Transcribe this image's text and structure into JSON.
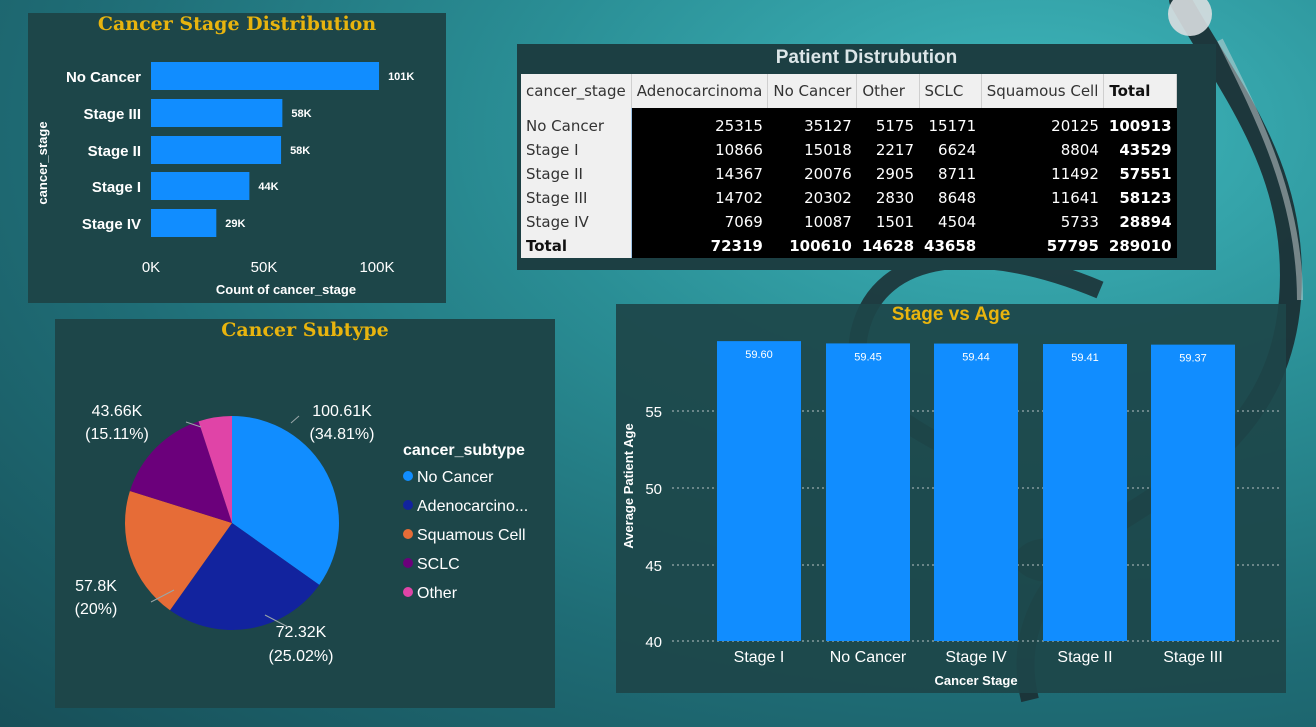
{
  "colors": {
    "bar": "#118dff",
    "title": "#e8b40e",
    "panel": "#1d4649"
  },
  "stage_chart": {
    "title": "Cancer Stage Distribution",
    "xlabel": "Count of cancer_stage",
    "ylabel": "cancer_stage",
    "ticks": [
      "0K",
      "50K",
      "100K"
    ]
  },
  "pivot": {
    "title": "Patient Distrubution",
    "columns": [
      "cancer_stage",
      "Adenocarcinoma",
      "No Cancer",
      "Other",
      "SCLC",
      "Squamous Cell",
      "Total"
    ],
    "rows": [
      [
        "No Cancer",
        "25315",
        "35127",
        "5175",
        "15171",
        "20125",
        "100913"
      ],
      [
        "Stage I",
        "10866",
        "15018",
        "2217",
        "6624",
        "8804",
        "43529"
      ],
      [
        "Stage II",
        "14367",
        "20076",
        "2905",
        "8711",
        "11492",
        "57551"
      ],
      [
        "Stage III",
        "14702",
        "20302",
        "2830",
        "8648",
        "11641",
        "58123"
      ],
      [
        "Stage IV",
        "7069",
        "10087",
        "1501",
        "4504",
        "5733",
        "28894"
      ]
    ],
    "total": [
      "Total",
      "72319",
      "100610",
      "14628",
      "43658",
      "57795",
      "289010"
    ]
  },
  "subtype_chart": {
    "title": "Cancer Subtype",
    "legend_title": "cancer_subtype",
    "legend": [
      "No Cancer",
      "Adenocarcino...",
      "Squamous Cell",
      "SCLC",
      "Other"
    ],
    "slice_labels": [
      {
        "value": "100.61K",
        "pct": "(34.81%)"
      },
      {
        "value": "72.32K",
        "pct": "(25.02%)"
      },
      {
        "value": "57.8K",
        "pct": "(20%)"
      },
      {
        "value": "43.66K",
        "pct": "(15.11%)"
      }
    ]
  },
  "age_chart": {
    "title": "Stage vs Age",
    "xlabel": "Cancer Stage",
    "ylabel": "Average Patient Age",
    "yticks": [
      "55",
      "50",
      "45",
      "40"
    ]
  },
  "chart_data": [
    {
      "type": "bar",
      "orientation": "horizontal",
      "title": "Cancer Stage Distribution",
      "xlabel": "Count of cancer_stage",
      "ylabel": "cancer_stage",
      "categories": [
        "No Cancer",
        "Stage III",
        "Stage II",
        "Stage I",
        "Stage IV"
      ],
      "values": [
        100913,
        58123,
        57551,
        43529,
        28894
      ],
      "data_labels": [
        "101K",
        "58K",
        "58K",
        "44K",
        "29K"
      ],
      "xlim": [
        0,
        120000
      ]
    },
    {
      "type": "pie",
      "title": "Cancer Subtype",
      "categories": [
        "No Cancer",
        "Adenocarcinoma",
        "Squamous Cell",
        "SCLC",
        "Other"
      ],
      "values": [
        100610,
        72319,
        57795,
        43658,
        14628
      ],
      "colors": [
        "#118dff",
        "#12239e",
        "#e66c37",
        "#6b007b",
        "#e044a7"
      ]
    },
    {
      "type": "bar",
      "title": "Stage vs Age",
      "xlabel": "Cancer Stage",
      "ylabel": "Average Patient Age",
      "categories": [
        "Stage I",
        "No Cancer",
        "Stage IV",
        "Stage II",
        "Stage III"
      ],
      "values": [
        59.6,
        59.45,
        59.44,
        59.41,
        59.37
      ],
      "data_labels": [
        "59.60",
        "59.45",
        "59.44",
        "59.41",
        "59.37"
      ],
      "ylim": [
        40,
        59.85
      ]
    }
  ]
}
